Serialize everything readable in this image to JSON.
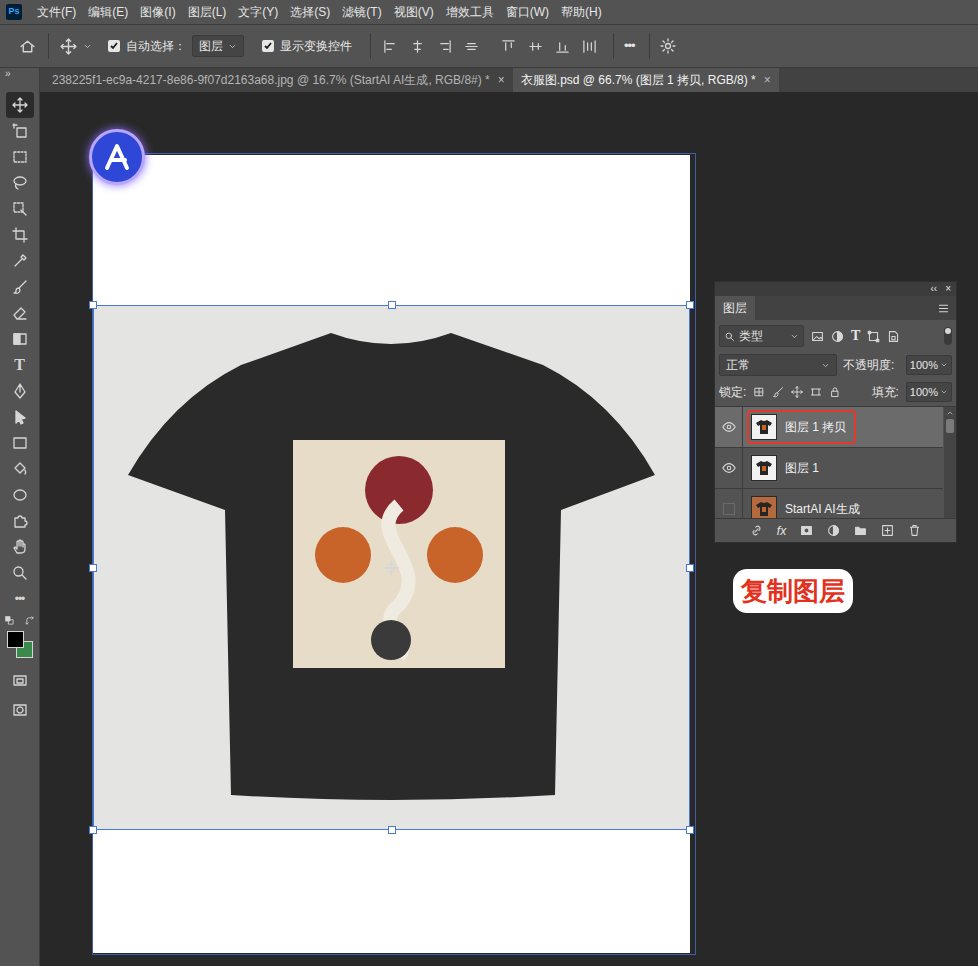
{
  "app": {
    "logo": "Ps"
  },
  "menu": [
    "文件(F)",
    "编辑(E)",
    "图像(I)",
    "图层(L)",
    "文字(Y)",
    "选择(S)",
    "滤镜(T)",
    "视图(V)",
    "增效工具",
    "窗口(W)",
    "帮助(H)"
  ],
  "options_bar": {
    "auto_select": {
      "label": "自动选择：",
      "checked": true
    },
    "auto_select_target": "图层",
    "show_transform_controls": {
      "label": "显示变换控件",
      "checked": true
    },
    "more": "•••"
  },
  "toolbar": {
    "collapse": "»",
    "tools": [
      {
        "selected": true
      },
      {
        "selected": false
      },
      {
        "selected": false
      },
      {
        "selected": false
      },
      {
        "selected": false
      },
      {
        "selected": false
      },
      {
        "selected": false
      },
      {
        "selected": false
      },
      {
        "selected": false
      },
      {
        "selected": false
      },
      {
        "glyph": "T",
        "selected": false
      },
      {
        "selected": false
      },
      {
        "selected": false
      },
      {
        "selected": false
      },
      {
        "selected": false
      },
      {
        "selected": false
      },
      {
        "selected": false
      },
      {
        "selected": false
      },
      {
        "selected": false
      },
      {
        "glyph": "•••",
        "selected": false
      }
    ],
    "foreground_color": "#000000",
    "background_color": "#3b8a4c"
  },
  "tabs": [
    {
      "label": "238225f1-ec9a-4217-8e86-9f07d2163a68.jpg @ 16.7% (StartAI AI生成, RGB/8#) *",
      "selected": false,
      "close": "×"
    },
    {
      "label": "衣服图.psd @ 66.7% (图层 1 拷贝, RGB/8) *",
      "selected": true,
      "close": "×"
    }
  ],
  "layers_panel": {
    "collapse": "‹‹",
    "close": "×",
    "title": "图层",
    "filter": "类型",
    "type_filter": "T",
    "blend_mode": "正常",
    "opacity_label": "不透明度:",
    "opacity": "100%",
    "lock_label": "锁定:",
    "fill_label": "填充:",
    "fill": "100%",
    "layers": [
      {
        "name": "图层 1 拷贝",
        "visible": true,
        "selected": true,
        "highlighted": true
      },
      {
        "name": "图层 1",
        "visible": true,
        "selected": false,
        "highlighted": false
      },
      {
        "name": "StartAI AI生成",
        "visible": false,
        "selected": false,
        "highlighted": false
      }
    ],
    "fx": "fx"
  },
  "annotation": "复制图层"
}
